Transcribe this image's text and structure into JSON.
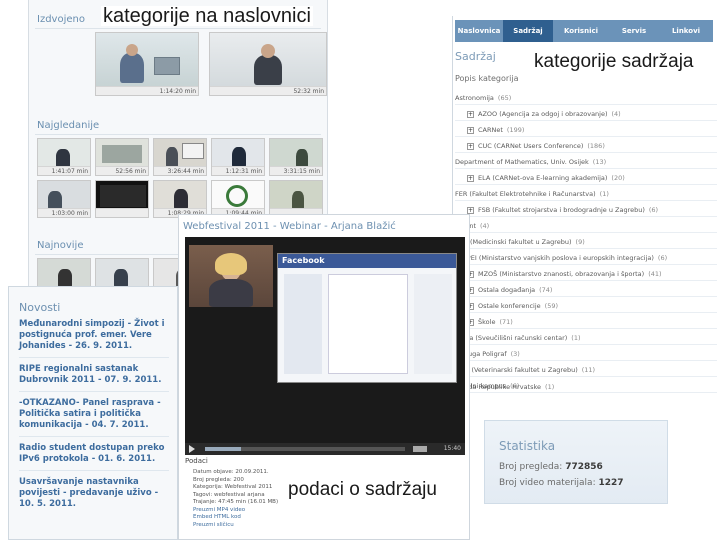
{
  "overlay_labels": {
    "home_categories": "kategorije na naslovnici",
    "content_categories": "kategorije sadržaja",
    "content_details": "podaci o sadržaju"
  },
  "home": {
    "featured_title": "Izdvojeno",
    "most_viewed_title": "Najgledanije",
    "newest_title": "Najnovije",
    "featured_thumbs": [
      {
        "duration": "1:14:20 min"
      },
      {
        "duration": "52:32 min"
      }
    ],
    "popular_thumbs": [
      {
        "duration": "1:41:07 min"
      },
      {
        "duration": "52:56 min"
      },
      {
        "duration": "3:26:44 min"
      },
      {
        "duration": "1:12:31 min"
      },
      {
        "duration": "3:31:15 min"
      },
      {
        "duration": "1:03:00 min"
      },
      {
        "duration": "1:08:29 min"
      },
      {
        "duration": "1:09:44 min"
      }
    ]
  },
  "nav": {
    "tabs": [
      "Naslovnica",
      "Sadržaj",
      "Korisnici",
      "Servis",
      "Linkovi"
    ],
    "active_index": 1
  },
  "content": {
    "heading": "Sadržaj",
    "list_heading": "Popis kategorija",
    "categories": [
      {
        "label": "Astronomija",
        "count": "(65)",
        "expand": false
      },
      {
        "label": "AZOO (Agencija za odgoj i obrazovanje)",
        "count": "(4)",
        "expand": true
      },
      {
        "label": "CARNet",
        "count": "(199)",
        "expand": true
      },
      {
        "label": "CUC (CARNet Users Conference)",
        "count": "(186)",
        "expand": true
      },
      {
        "label": "Department of Mathematics, Univ. Osijek",
        "count": "(13)",
        "expand": false
      },
      {
        "label": "ELA (CARNet-ova E-learning akademija)",
        "count": "(20)",
        "expand": true
      },
      {
        "label": "FER (Fakultet Elektrotehnike i Računarstva)",
        "count": "(1)",
        "expand": false
      },
      {
        "label": "FSB (Fakultet strojarstva i brodogradnje u Zagrebu)",
        "count": "(6)",
        "expand": true
      },
      {
        "label": "...dent",
        "count": "(4)",
        "expand": false
      },
      {
        "label": "...UI (Medicinski fakultet u Zagrebu)",
        "count": "(9)",
        "expand": false
      },
      {
        "label": "...MPEI (Ministarstvo vanjskih poslova i europskih integracija)",
        "count": "(6)",
        "expand": false
      },
      {
        "label": "MZOŠ (Ministarstvo znanosti, obrazovanja i športa)",
        "count": "(41)",
        "expand": true
      },
      {
        "label": "Ostala događanja",
        "count": "(74)",
        "expand": true
      },
      {
        "label": "Ostale konferencije",
        "count": "(59)",
        "expand": true
      },
      {
        "label": "Škole",
        "count": "(71)",
        "expand": true
      },
      {
        "label": "...ena (Sveučilišni računski centar)",
        "count": "(1)",
        "expand": false
      },
      {
        "label": "...druga Poligraf",
        "count": "(3)",
        "expand": false
      },
      {
        "label": "...VF (Veterinarski fakultet u Zagrebu)",
        "count": "(11)",
        "expand": false
      },
      {
        "label": "...učilni kampus",
        "count": "(6)",
        "expand": false
      },
      {
        "label": "...ada Republike Hrvatske",
        "count": "(1)",
        "expand": false
      }
    ]
  },
  "player": {
    "title": "Webfestival 2011 - Webinar - Arjana Blažić",
    "slide_site": "Facebook",
    "time": "15:40",
    "details_title": "Podaci",
    "meta": [
      "Datum objave: 20.09.2011.",
      "Broj pregleda: 200",
      "Kategorija: Webfestival 2011",
      "Tagovi: webfestival arjana",
      "Trajanje: 47:45 min (16.01 MB)",
      "Preuzmi MP4 video",
      "Embed HTML kod",
      "Preuzmi sličicu"
    ]
  },
  "news": {
    "title": "Novosti",
    "items": [
      "Međunarodni simpozij - Život i postignuća prof. emer. Vere Johanides - 26. 9. 2011.",
      "RIPE regionalni sastanak Dubrovnik 2011 - 07. 9. 2011.",
      "-OTKAZANO- Panel rasprava - Politička satira i politička komunikacija - 04. 7. 2011.",
      "Radio student dostupan preko IPv6 protokola - 01. 6. 2011.",
      "Usavršavanje nastavnika povijesti - predavanje uživo - 10. 5. 2011."
    ]
  },
  "stats": {
    "title": "Statistika",
    "views_label": "Broj pregleda:",
    "views_value": "772856",
    "videos_label": "Broj video materijala:",
    "videos_value": "1227"
  },
  "colors": {
    "nav_bg": "#6b93b9",
    "nav_active": "#2f5f8f",
    "accent_blue": "#3d6c9e",
    "panel_border": "#c8d6e3"
  }
}
